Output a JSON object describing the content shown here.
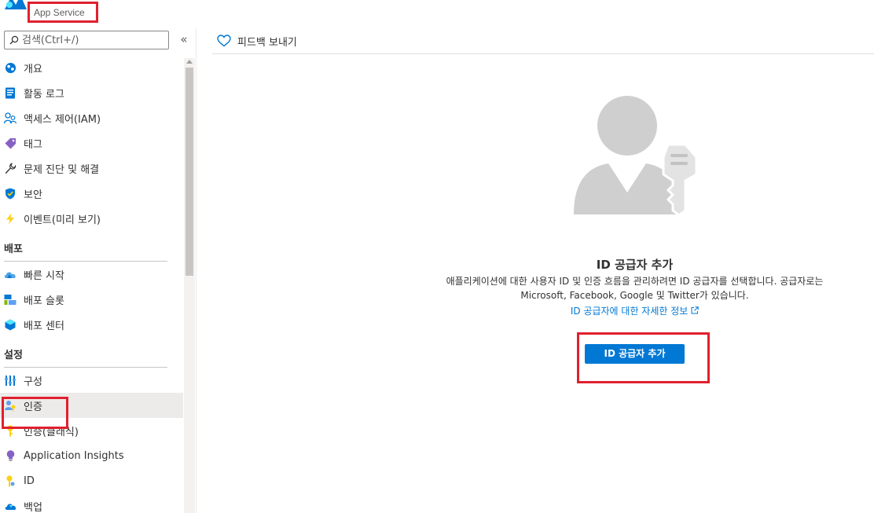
{
  "header": {
    "resource_type": "App Service"
  },
  "search": {
    "placeholder": "검색(Ctrl+/)"
  },
  "collapse_label": "«",
  "nav": {
    "top_items": [
      {
        "label": "개요",
        "icon": "overview-icon"
      },
      {
        "label": "활동 로그",
        "icon": "activity-log-icon"
      },
      {
        "label": "액세스 제어(IAM)",
        "icon": "access-control-icon"
      },
      {
        "label": "태그",
        "icon": "tag-icon"
      },
      {
        "label": "문제 진단 및 해결",
        "icon": "wrench-icon"
      },
      {
        "label": "보안",
        "icon": "shield-icon"
      },
      {
        "label": "이벤트(미리 보기)",
        "icon": "lightning-icon"
      }
    ],
    "section_deploy": {
      "title": "배포",
      "items": [
        {
          "label": "빠른 시작",
          "icon": "quickstart-icon"
        },
        {
          "label": "배포 슬롯",
          "icon": "deployment-slot-icon"
        },
        {
          "label": "배포 센터",
          "icon": "deployment-center-icon"
        }
      ]
    },
    "section_settings": {
      "title": "설정",
      "items": [
        {
          "label": "구성",
          "icon": "configuration-icon"
        },
        {
          "label": "인증",
          "icon": "authentication-icon",
          "active": true
        },
        {
          "label": "인증(클래식)",
          "icon": "key-icon"
        },
        {
          "label": "Application Insights",
          "icon": "lightbulb-icon"
        },
        {
          "label": "ID",
          "icon": "identity-key-icon"
        },
        {
          "label": "백업",
          "icon": "backup-cloud-icon"
        }
      ]
    }
  },
  "command_bar": {
    "feedback_label": "피드백 보내기"
  },
  "empty_state": {
    "title": "ID 공급자 추가",
    "description_line1": "애플리케이션에 대한 사용자 ID 및 인증 흐름을 관리하려면 ID 공급자를 선택합니다. 공급자로는",
    "description_line2": "Microsoft, Facebook, Google 및 Twitter가 있습니다.",
    "learn_more": "ID 공급자에 대한 자세한 정보",
    "button_label": "ID 공급자 추가"
  },
  "colors": {
    "accent": "#0078d4",
    "highlight_box": "#e0202e",
    "active_item_bg": "#edebe9"
  }
}
